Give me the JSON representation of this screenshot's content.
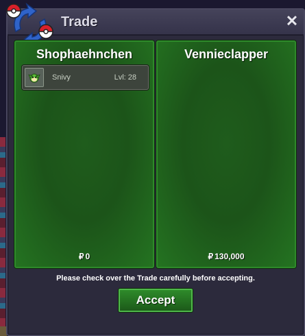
{
  "window": {
    "title": "Trade",
    "close_label": "✕",
    "logo_icon": "trade-exchange-icon"
  },
  "left_panel": {
    "player_name": "Shophaehnchen",
    "items": [
      {
        "pokemon_name": "Snivy",
        "level_label": "Lvl: 28",
        "icon": "snivy-icon"
      }
    ],
    "currency_symbol": "₽",
    "money": "0"
  },
  "right_panel": {
    "player_name": "Vennieclapper",
    "items": [],
    "currency_symbol": "₽",
    "money": "130,000"
  },
  "notice": "Please check over the Trade carefully before accepting.",
  "accept_label": "Accept",
  "colors": {
    "panel_green": "#1f5c1c",
    "panel_border": "#2e8a2a",
    "window_bg": "#2c2a3c",
    "titlebar": "#3e3c52"
  }
}
